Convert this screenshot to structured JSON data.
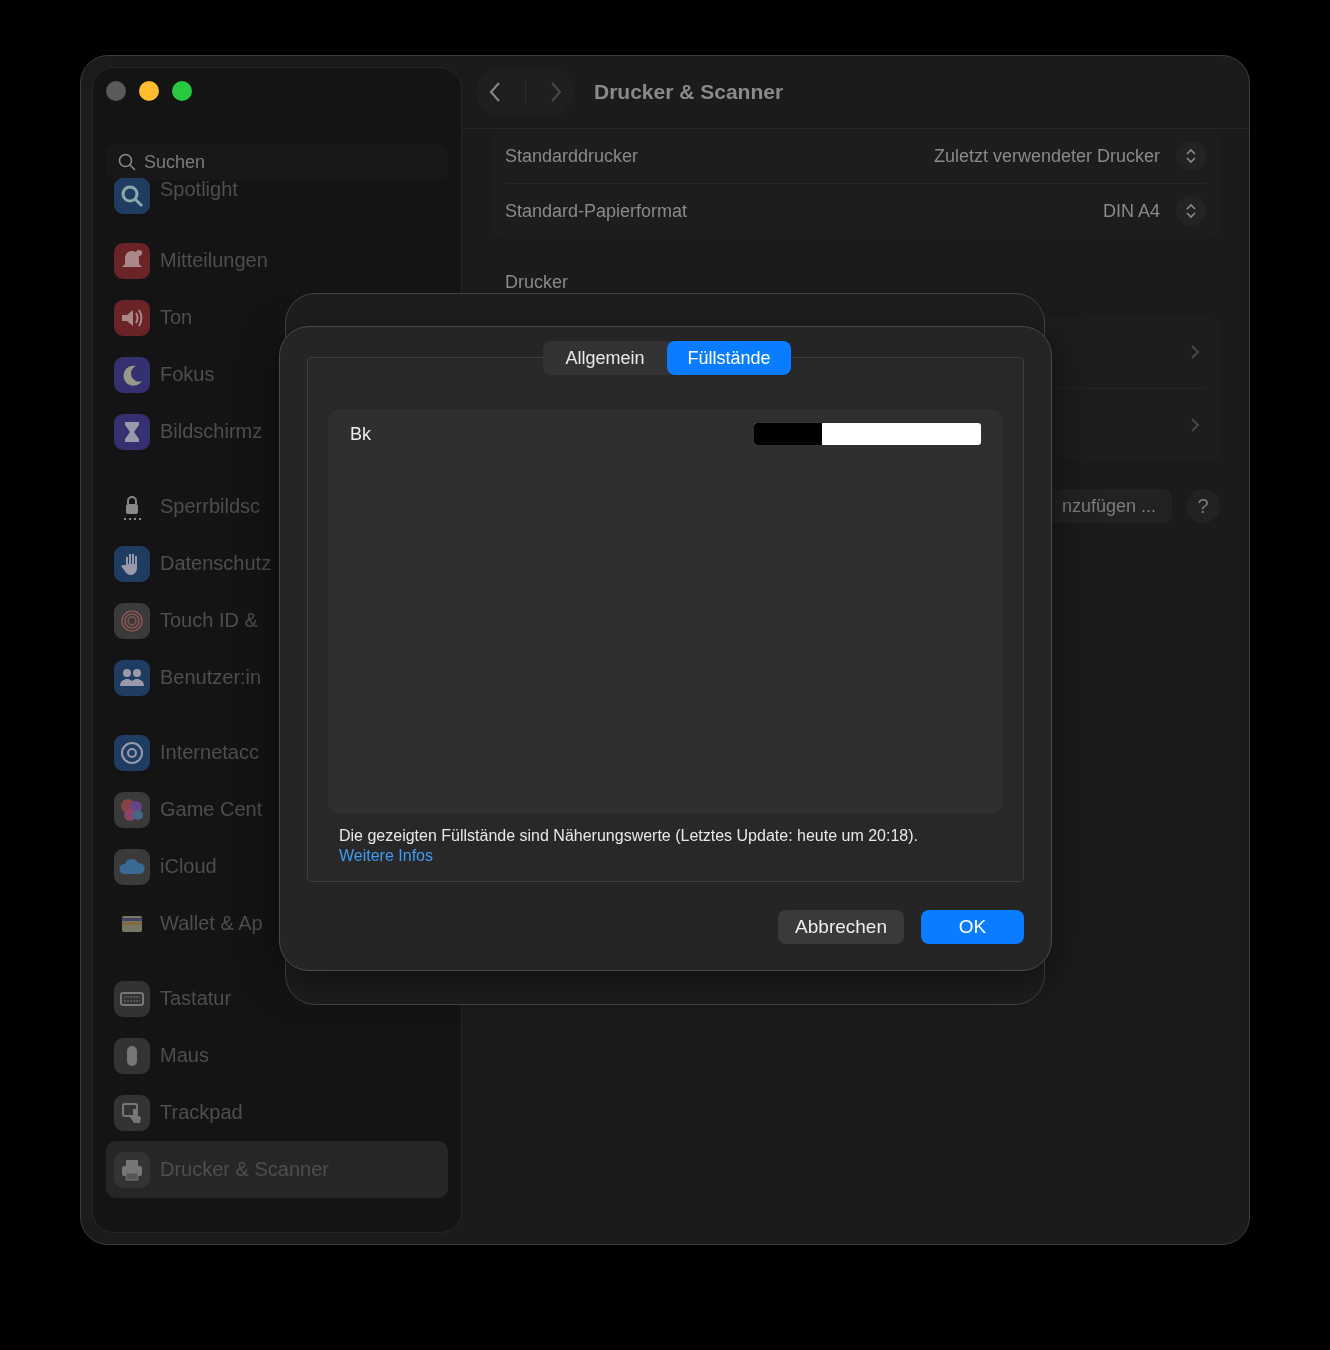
{
  "sidebar": {
    "search": {
      "placeholder": "Suchen"
    },
    "groups": [
      {
        "items": [
          {
            "label": "Spotlight",
            "color": "#1f3d63",
            "selected": false
          }
        ]
      },
      {
        "items": [
          {
            "label": "Mitteilungen",
            "color": "#6a2326",
            "selected": false
          },
          {
            "label": "Ton",
            "color": "#6a2326",
            "selected": false
          },
          {
            "label": "Fokus",
            "color": "#353070",
            "selected": false
          },
          {
            "label": "Bildschirmz",
            "color": "#353070",
            "selected": false
          }
        ]
      },
      {
        "items": [
          {
            "label": "Sperrbildsc",
            "color": "#151515",
            "selected": false
          },
          {
            "label": "Datenschutz",
            "color": "#1f3d63",
            "selected": false
          },
          {
            "label": "Touch ID &",
            "color": "#3a3a3a",
            "selected": false
          },
          {
            "label": "Benutzer:in",
            "color": "#1f3d63",
            "selected": false
          }
        ]
      },
      {
        "items": [
          {
            "label": "Internetacc",
            "color": "#1f3d63",
            "selected": false
          },
          {
            "label": "Game Cent",
            "color": "#3a3a3a",
            "selected": false
          },
          {
            "label": "iCloud",
            "color": "#3a3a3a",
            "selected": false
          },
          {
            "label": "Wallet & Ap",
            "color": "#151515",
            "selected": false
          }
        ]
      },
      {
        "items": [
          {
            "label": "Tastatur",
            "color": "#333333",
            "selected": false
          },
          {
            "label": "Maus",
            "color": "#333333",
            "selected": false
          },
          {
            "label": "Trackpad",
            "color": "#333333",
            "selected": false
          },
          {
            "label": "Drucker & Scanner",
            "color": "#333333",
            "selected": true
          }
        ]
      }
    ]
  },
  "pane": {
    "title": "Drucker & Scanner",
    "settings": [
      {
        "label": "Standarddrucker",
        "value": "Zuletzt verwendeter Drucker"
      },
      {
        "label": "Standard-Papierformat",
        "value": "DIN A4"
      }
    ],
    "printers_heading": "Drucker",
    "add_button": "nzufügen ...",
    "help_button": "?"
  },
  "dialog": {
    "tabs": [
      {
        "label": "Allgemein",
        "selected": false
      },
      {
        "label": "Füllstände",
        "selected": true
      }
    ],
    "supplies": [
      {
        "name": "Bk",
        "level": 0.3
      }
    ],
    "note": "Die gezeigten Füllstände sind Näherungswerte (Letztes Update: heute um 20:18).",
    "link": "Weitere Infos",
    "buttons": [
      {
        "label": "Abbrechen",
        "kind": "secondary"
      },
      {
        "label": "OK",
        "kind": "primary"
      }
    ]
  }
}
